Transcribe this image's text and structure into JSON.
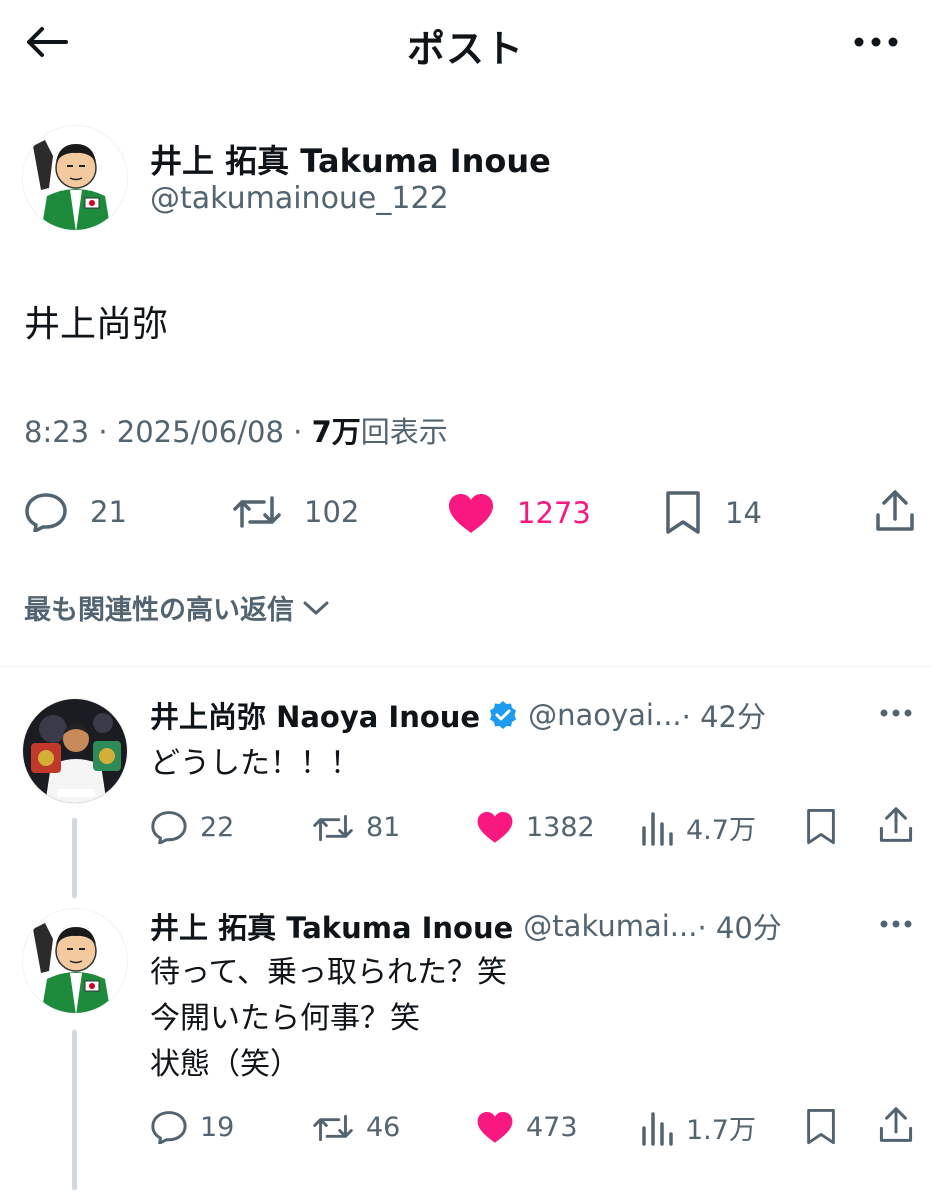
{
  "header": {
    "title": "ポスト"
  },
  "post": {
    "author_name": "井上 拓真  Takuma Inoue",
    "author_handle": "@takumainoue_122",
    "text": "井上尚弥",
    "time": "8:23",
    "date": "2025/06/08",
    "views_count": "7万",
    "views_label": "回表示",
    "meta_separator": "·",
    "replies": "21",
    "reposts": "102",
    "likes": "1273",
    "bookmarks": "14",
    "liked": true,
    "like_color": "#f91880"
  },
  "sort": {
    "label": "最も関連性の高い返信"
  },
  "replies": [
    {
      "author_name": "井上尚弥  Naoya Inoue",
      "verified": true,
      "handle": "@naoyai...",
      "time": "· 42分",
      "text": "どうした！！！",
      "replies": "22",
      "reposts": "81",
      "likes": "1382",
      "views": "4.7万"
    },
    {
      "author_name": "井上 拓真  Takuma Inoue",
      "verified": false,
      "handle": "@takumai...",
      "time": "· 40分",
      "text": "待って、乗っ取られた？笑\n今開いたら何事？笑\n状態（笑）",
      "replies": "19",
      "reposts": "46",
      "likes": "473",
      "views": "1.7万"
    }
  ],
  "colors": {
    "text": "#0f1419",
    "secondary": "#536471",
    "like": "#f91880",
    "verified": "#1d9bf0",
    "thread_line": "#cfd9de"
  }
}
